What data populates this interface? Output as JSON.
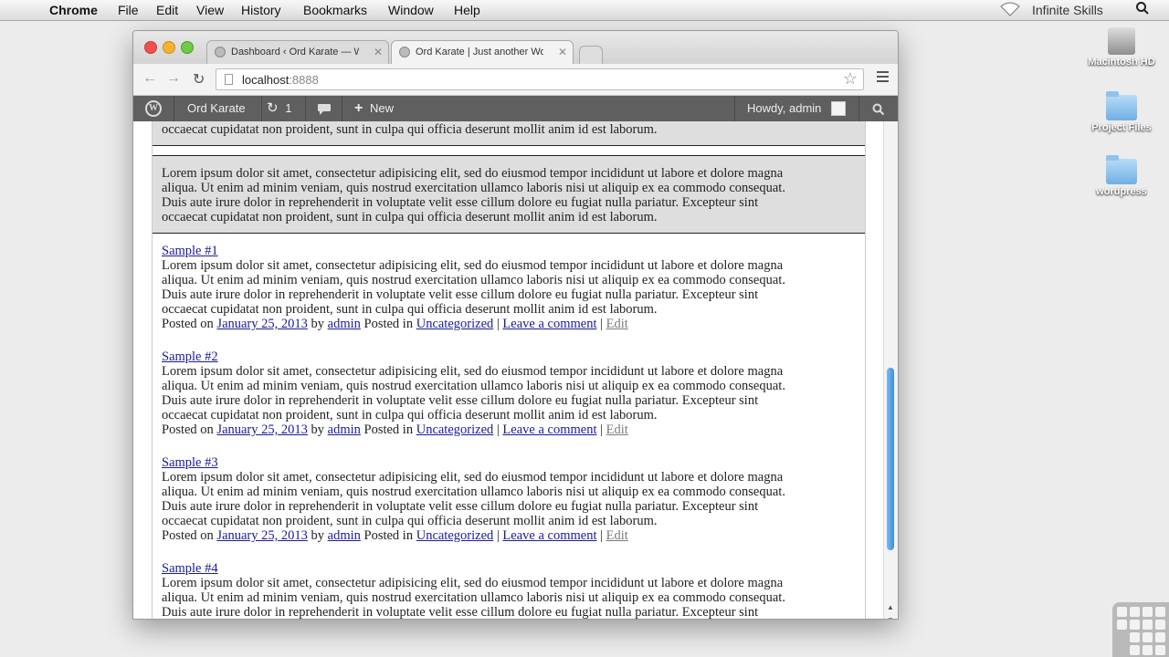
{
  "menubar": {
    "app": "Chrome",
    "items": [
      "File",
      "Edit",
      "View",
      "History",
      "Bookmarks",
      "Window",
      "Help"
    ],
    "right_label": "Infinite Skills"
  },
  "desktop": {
    "icons": [
      {
        "label": "Macintosh HD",
        "icon": "hard-drive-icon"
      },
      {
        "label": "Project Files",
        "icon": "folder-icon"
      },
      {
        "label": "wordpress",
        "icon": "folder-icon"
      }
    ]
  },
  "browser": {
    "tabs": [
      {
        "title": "Dashboard ‹ Ord Karate — W",
        "active": false
      },
      {
        "title": "Ord Karate | Just another Wo",
        "active": true
      }
    ],
    "url_host": "localhost",
    "url_port": ":8888"
  },
  "adminbar": {
    "site": "Ord Karate",
    "updates": "1",
    "new_label": "New",
    "howdy": "Howdy, admin"
  },
  "content": {
    "top_fragment": "occaecat cupidatat non proident, sunt in culpa qui officia deserunt mollit anim id est laborum.",
    "gray_lines": [
      "Lorem ipsum dolor sit amet, consectetur adipisicing elit, sed do eiusmod tempor incididunt ut labore et dolore magna",
      "aliqua. Ut enim ad minim veniam, quis nostrud exercitation ullamco laboris nisi ut aliquip ex ea commodo consequat.",
      "Duis aute irure dolor in reprehenderit in voluptate velit esse cillum dolore eu fugiat nulla pariatur. Excepteur sint",
      "occaecat cupidatat non proident, sunt in culpa qui officia deserunt mollit anim id est laborum."
    ],
    "posts": [
      {
        "title": "Sample #1"
      },
      {
        "title": "Sample #2"
      },
      {
        "title": "Sample #3"
      },
      {
        "title": "Sample #4"
      }
    ],
    "body_lines": [
      "Lorem ipsum dolor sit amet, consectetur adipisicing elit, sed do eiusmod tempor incididunt ut labore et dolore magna",
      "aliqua. Ut enim ad minim veniam, quis nostrud exercitation ullamco laboris nisi ut aliquip ex ea commodo consequat.",
      "Duis aute irure dolor in reprehenderit in voluptate velit esse cillum dolore eu fugiat nulla pariatur. Excepteur sint",
      "occaecat cupidatat non proident, sunt in culpa qui officia deserunt mollit anim id est laborum."
    ],
    "meta": {
      "posted_on": "Posted on",
      "date": "January 25, 2013",
      "by": "by",
      "author": "admin",
      "posted_in": "Posted in",
      "category": "Uncategorized",
      "sep": "|",
      "comment": "Leave a comment",
      "edit": "Edit"
    }
  }
}
